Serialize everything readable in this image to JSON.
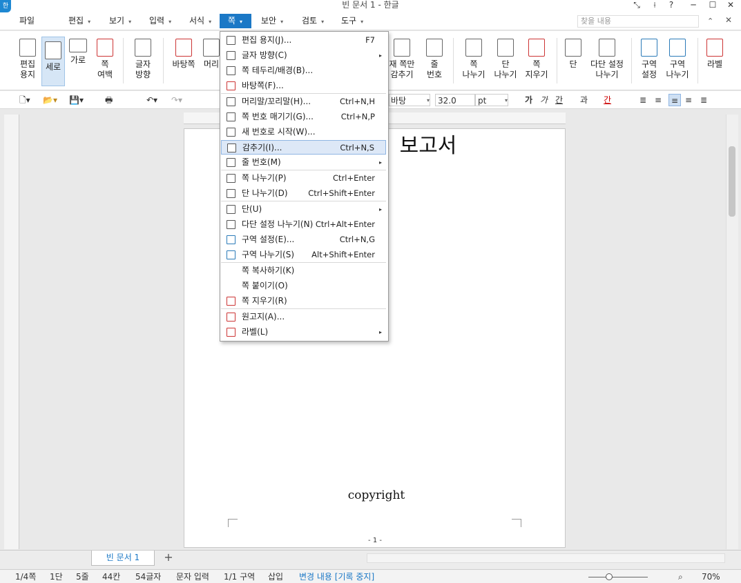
{
  "window": {
    "title": "빈 문서 1 - 한글",
    "logo_text": "한"
  },
  "window_controls": [
    "⤡",
    "⟊",
    "?",
    "─",
    "☐",
    "✕"
  ],
  "menubar": {
    "items": [
      "파일",
      "편집",
      "보기",
      "입력",
      "서식",
      "쪽",
      "보안",
      "검토",
      "도구"
    ],
    "search_placeholder": "찾을 내용"
  },
  "ribbon": {
    "buttons": [
      {
        "label": "편집\n용지"
      },
      {
        "label": "세로"
      },
      {
        "label": "가로"
      },
      {
        "label": "쪽\n여백"
      },
      {
        "label": "글자\n방향"
      },
      {
        "label": "바탕쪽"
      },
      {
        "label": "머리"
      },
      {
        "label": "재 쪽만\n감추기"
      },
      {
        "label": "줄\n번호"
      },
      {
        "label": "쪽\n나누기"
      },
      {
        "label": "단\n나누기"
      },
      {
        "label": "쪽\n지우기"
      },
      {
        "label": "단"
      },
      {
        "label": "다단 설정\n나누기"
      },
      {
        "label": "구역\n설정"
      },
      {
        "label": "구역\n나누기"
      },
      {
        "label": "라벨"
      }
    ]
  },
  "toolbar": {
    "style_value": "바탕",
    "font_size": "32.0",
    "font_unit": "pt",
    "style_buttons": [
      "가",
      "가",
      "간",
      "과",
      "간"
    ]
  },
  "document": {
    "title": "보고서",
    "footer": "copyright",
    "page_number": "- 1 -"
  },
  "tabs": {
    "doc_tab": "빈 문서 1",
    "add_label": "+"
  },
  "status": {
    "page": "1/4쪽",
    "column": "1단",
    "line": "5줄",
    "char_col": "44칸",
    "chars": "54글자",
    "mode": "문자 입력",
    "section": "1/1 구역",
    "insert": "삽입",
    "track": "변경 내용 [기록 중지]",
    "zoom": "70%"
  },
  "dropdown": {
    "items": [
      {
        "label": "편집 용지(J)...",
        "shortcut": "F7"
      },
      {
        "label": "글자 방향(C)",
        "submenu": true
      },
      {
        "label": "쪽 테두리/배경(B)..."
      },
      {
        "label": "바탕쪽(F)..."
      },
      {
        "label": "머리말/꼬리말(H)...",
        "shortcut": "Ctrl+N,H"
      },
      {
        "label": "쪽 번호 매기기(G)...",
        "shortcut": "Ctrl+N,P"
      },
      {
        "label": "새 번호로 시작(W)..."
      },
      {
        "label": "감추기(I)...",
        "shortcut": "Ctrl+N,S"
      },
      {
        "label": "줄 번호(M)",
        "submenu": true
      },
      {
        "label": "쪽 나누기(P)",
        "shortcut": "Ctrl+Enter"
      },
      {
        "label": "단 나누기(D)",
        "shortcut": "Ctrl+Shift+Enter"
      },
      {
        "label": "단(U)",
        "submenu": true
      },
      {
        "label": "다단 설정 나누기(N)",
        "shortcut": "Ctrl+Alt+Enter"
      },
      {
        "label": "구역 설정(E)...",
        "shortcut": "Ctrl+N,G"
      },
      {
        "label": "구역 나누기(S)",
        "shortcut": "Alt+Shift+Enter"
      },
      {
        "label": "쪽 복사하기(K)"
      },
      {
        "label": "쪽 붙이기(O)"
      },
      {
        "label": "쪽 지우기(R)"
      },
      {
        "label": "원고지(A)..."
      },
      {
        "label": "라벨(L)",
        "submenu": true
      }
    ]
  }
}
